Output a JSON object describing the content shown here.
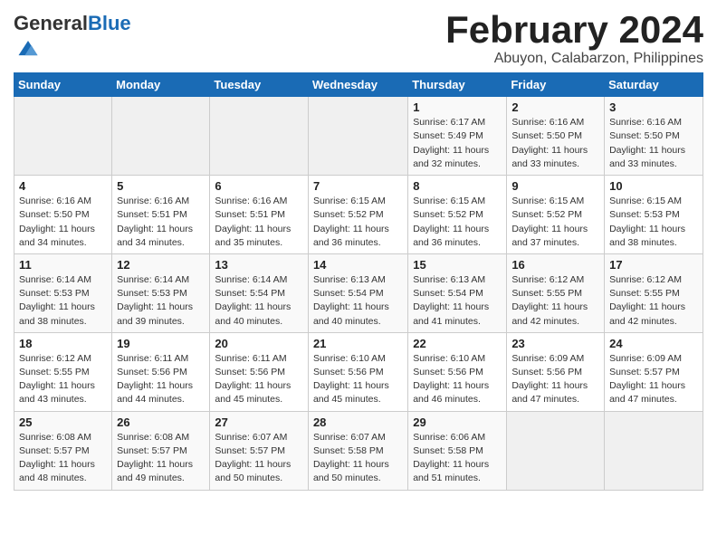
{
  "header": {
    "logo_general": "General",
    "logo_blue": "Blue",
    "month_title": "February 2024",
    "location": "Abuyon, Calabarzon, Philippines"
  },
  "days_of_week": [
    "Sunday",
    "Monday",
    "Tuesday",
    "Wednesday",
    "Thursday",
    "Friday",
    "Saturday"
  ],
  "weeks": [
    [
      {
        "day": "",
        "info": ""
      },
      {
        "day": "",
        "info": ""
      },
      {
        "day": "",
        "info": ""
      },
      {
        "day": "",
        "info": ""
      },
      {
        "day": "1",
        "info": "Sunrise: 6:17 AM\nSunset: 5:49 PM\nDaylight: 11 hours and 32 minutes."
      },
      {
        "day": "2",
        "info": "Sunrise: 6:16 AM\nSunset: 5:50 PM\nDaylight: 11 hours and 33 minutes."
      },
      {
        "day": "3",
        "info": "Sunrise: 6:16 AM\nSunset: 5:50 PM\nDaylight: 11 hours and 33 minutes."
      }
    ],
    [
      {
        "day": "4",
        "info": "Sunrise: 6:16 AM\nSunset: 5:50 PM\nDaylight: 11 hours and 34 minutes."
      },
      {
        "day": "5",
        "info": "Sunrise: 6:16 AM\nSunset: 5:51 PM\nDaylight: 11 hours and 34 minutes."
      },
      {
        "day": "6",
        "info": "Sunrise: 6:16 AM\nSunset: 5:51 PM\nDaylight: 11 hours and 35 minutes."
      },
      {
        "day": "7",
        "info": "Sunrise: 6:15 AM\nSunset: 5:52 PM\nDaylight: 11 hours and 36 minutes."
      },
      {
        "day": "8",
        "info": "Sunrise: 6:15 AM\nSunset: 5:52 PM\nDaylight: 11 hours and 36 minutes."
      },
      {
        "day": "9",
        "info": "Sunrise: 6:15 AM\nSunset: 5:52 PM\nDaylight: 11 hours and 37 minutes."
      },
      {
        "day": "10",
        "info": "Sunrise: 6:15 AM\nSunset: 5:53 PM\nDaylight: 11 hours and 38 minutes."
      }
    ],
    [
      {
        "day": "11",
        "info": "Sunrise: 6:14 AM\nSunset: 5:53 PM\nDaylight: 11 hours and 38 minutes."
      },
      {
        "day": "12",
        "info": "Sunrise: 6:14 AM\nSunset: 5:53 PM\nDaylight: 11 hours and 39 minutes."
      },
      {
        "day": "13",
        "info": "Sunrise: 6:14 AM\nSunset: 5:54 PM\nDaylight: 11 hours and 40 minutes."
      },
      {
        "day": "14",
        "info": "Sunrise: 6:13 AM\nSunset: 5:54 PM\nDaylight: 11 hours and 40 minutes."
      },
      {
        "day": "15",
        "info": "Sunrise: 6:13 AM\nSunset: 5:54 PM\nDaylight: 11 hours and 41 minutes."
      },
      {
        "day": "16",
        "info": "Sunrise: 6:12 AM\nSunset: 5:55 PM\nDaylight: 11 hours and 42 minutes."
      },
      {
        "day": "17",
        "info": "Sunrise: 6:12 AM\nSunset: 5:55 PM\nDaylight: 11 hours and 42 minutes."
      }
    ],
    [
      {
        "day": "18",
        "info": "Sunrise: 6:12 AM\nSunset: 5:55 PM\nDaylight: 11 hours and 43 minutes."
      },
      {
        "day": "19",
        "info": "Sunrise: 6:11 AM\nSunset: 5:56 PM\nDaylight: 11 hours and 44 minutes."
      },
      {
        "day": "20",
        "info": "Sunrise: 6:11 AM\nSunset: 5:56 PM\nDaylight: 11 hours and 45 minutes."
      },
      {
        "day": "21",
        "info": "Sunrise: 6:10 AM\nSunset: 5:56 PM\nDaylight: 11 hours and 45 minutes."
      },
      {
        "day": "22",
        "info": "Sunrise: 6:10 AM\nSunset: 5:56 PM\nDaylight: 11 hours and 46 minutes."
      },
      {
        "day": "23",
        "info": "Sunrise: 6:09 AM\nSunset: 5:56 PM\nDaylight: 11 hours and 47 minutes."
      },
      {
        "day": "24",
        "info": "Sunrise: 6:09 AM\nSunset: 5:57 PM\nDaylight: 11 hours and 47 minutes."
      }
    ],
    [
      {
        "day": "25",
        "info": "Sunrise: 6:08 AM\nSunset: 5:57 PM\nDaylight: 11 hours and 48 minutes."
      },
      {
        "day": "26",
        "info": "Sunrise: 6:08 AM\nSunset: 5:57 PM\nDaylight: 11 hours and 49 minutes."
      },
      {
        "day": "27",
        "info": "Sunrise: 6:07 AM\nSunset: 5:57 PM\nDaylight: 11 hours and 50 minutes."
      },
      {
        "day": "28",
        "info": "Sunrise: 6:07 AM\nSunset: 5:58 PM\nDaylight: 11 hours and 50 minutes."
      },
      {
        "day": "29",
        "info": "Sunrise: 6:06 AM\nSunset: 5:58 PM\nDaylight: 11 hours and 51 minutes."
      },
      {
        "day": "",
        "info": ""
      },
      {
        "day": "",
        "info": ""
      }
    ]
  ]
}
